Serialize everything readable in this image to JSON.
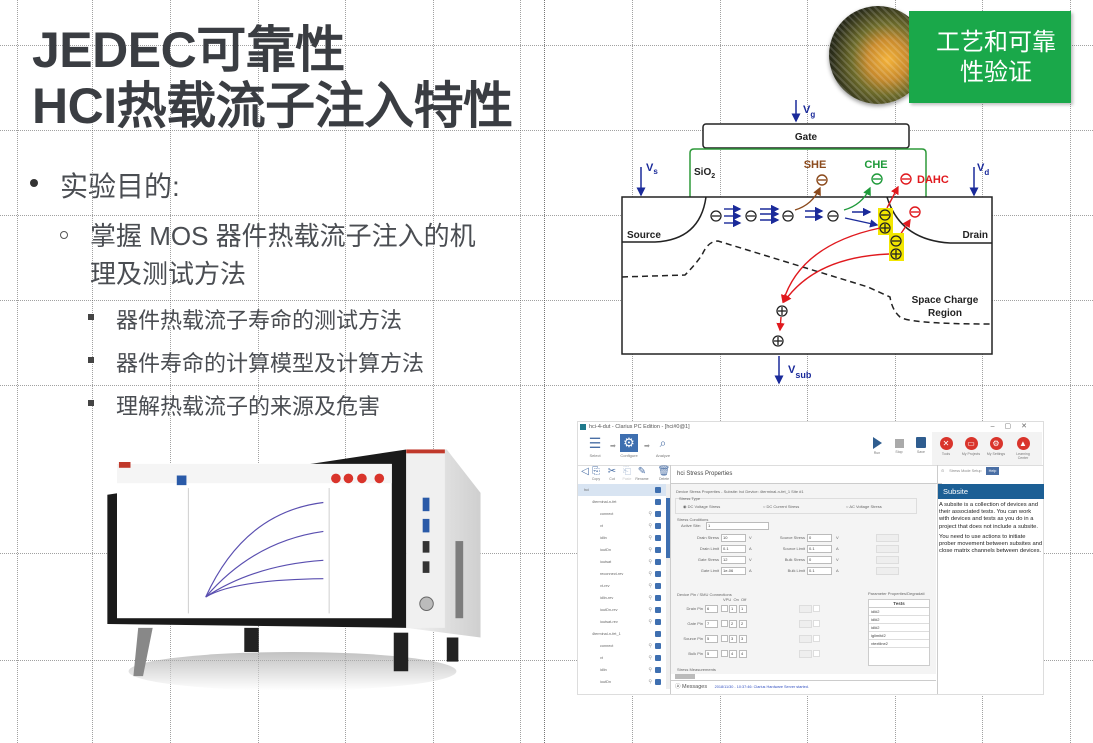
{
  "slide": {
    "title_line1": "JEDEC可靠性",
    "title_line2": "HCI热载流子注入特性",
    "badge_text_line1": "工艺和可靠",
    "badge_text_line2": "性验证",
    "badge_color": "#1aa84a",
    "title_color": "#3a3d42"
  },
  "bullets": {
    "level1": "实验目的:",
    "level2": "掌握 MOS 器件热载流子注入的机理及测试方法",
    "level3": [
      "器件热载流子寿命的测试方法",
      "器件寿命的计算模型及计算方法",
      "理解热载流子的来源及危害"
    ]
  },
  "diagram": {
    "labels": {
      "vg": "V",
      "vg_sub": "g",
      "vs": "V",
      "vs_sub": "s",
      "vd": "V",
      "vd_sub": "d",
      "vsub": "V",
      "vsub_sub": "sub",
      "gate": "Gate",
      "sio2": "SiO",
      "sio2_sub": "2",
      "source": "Source",
      "drain": "Drain",
      "she": "SHE",
      "che": "CHE",
      "dahc": "DAHC",
      "scr_line1": "Space Charge",
      "scr_line2": "Region"
    },
    "colors": {
      "she": "#8b4a1c",
      "che": "#1f9a3a",
      "dahc": "#e0191e",
      "arrows": "#1a2a9a",
      "oxide": "#2e9a3a",
      "highlight": "#f2e600"
    }
  },
  "app": {
    "window_title": "hci-4-dut - Clarius PC Edition - [hci#0@1]",
    "workflow": [
      "Select",
      "Configure",
      "Analyze"
    ],
    "toolbar": [
      "Run",
      "Stop",
      "Save"
    ],
    "toolbar_red": [
      "Tools",
      "My Projects",
      "My Settings",
      "Learning Center"
    ],
    "left_tools": [
      "Copy",
      "Cut",
      "Paste",
      "Rename",
      "Delete"
    ],
    "tree": [
      {
        "label": "hci",
        "level": 0,
        "selected": true
      },
      {
        "label": "4terminal-n-fet",
        "level": 1
      },
      {
        "label": "connect",
        "level": 2
      },
      {
        "label": "vt",
        "level": 2
      },
      {
        "label": "idlin",
        "level": 2
      },
      {
        "label": "ioutDn",
        "level": 2
      },
      {
        "label": "ioutsat",
        "level": 2
      },
      {
        "label": "reconnect-rev",
        "level": 2
      },
      {
        "label": "vt-rev",
        "level": 2
      },
      {
        "label": "idlin-rev",
        "level": 2
      },
      {
        "label": "ioutDn-rev",
        "level": 2
      },
      {
        "label": "ioutsat-rev",
        "level": 2
      },
      {
        "label": "4terminal-n-fet_1",
        "level": 1
      },
      {
        "label": "connect",
        "level": 2
      },
      {
        "label": "vt",
        "level": 2
      },
      {
        "label": "idlin",
        "level": 2
      },
      {
        "label": "ioutDn",
        "level": 2
      }
    ],
    "center_header": "hci Stress Properties",
    "device_props": "Device Stress Properties -  Subsite: hci  Device: 4terminal-n-fet_1  Site #1",
    "stress_type_label": "Stress Type",
    "stress_types": [
      "DC Voltage Stress",
      "DC Current Stress",
      "AC Voltage Stress"
    ],
    "stress_conditions_label": "Stress Conditions",
    "active_site_label": "Active Site:",
    "active_site_value": "1",
    "fields_left": [
      {
        "label": "Drain Stress",
        "value": "10",
        "unit": "V"
      },
      {
        "label": "Drain Limit",
        "value": "0.1",
        "unit": "A"
      },
      {
        "label": "Gate Stress",
        "value": "12",
        "unit": "V"
      },
      {
        "label": "Gate Limit",
        "value": "1e-06",
        "unit": "A"
      }
    ],
    "fields_right": [
      {
        "label": "Source Stress",
        "value": "0",
        "unit": "V"
      },
      {
        "label": "Source Limit",
        "value": "0.1",
        "unit": "A"
      },
      {
        "label": "Bulk Stress",
        "value": "0",
        "unit": "V"
      },
      {
        "label": "Bulk Limit",
        "value": "0.1",
        "unit": "A"
      }
    ],
    "pins_label": "Device Pin / SMU Connections",
    "pins_header": [
      "VPU",
      "On",
      "Off"
    ],
    "pins": [
      {
        "label": "Drain Pin",
        "value": "6",
        "on": "1",
        "off": "1"
      },
      {
        "label": "Gate Pin",
        "value": "7",
        "on": "2",
        "off": "2"
      },
      {
        "label": "Source Pin",
        "value": "5",
        "on": "3",
        "off": "3"
      },
      {
        "label": "Bulk Pin",
        "value": "5",
        "on": "4",
        "off": "4"
      }
    ],
    "param_label": "Parameter Properties/Degradati",
    "tests_header": "Tests",
    "tests": [
      "idl#2",
      "idl#2",
      "idl#2",
      "iglimit#2",
      "vtextline2"
    ],
    "stress_measurements_label": "Stress Measurements",
    "messages_label": "Messages",
    "message_text": "2018/11/30 - 10:37:46: Clarius Hardware Server started.",
    "right_tabs": [
      "Stress Mode Setup",
      "Help"
    ],
    "help_title": "Subsite",
    "help_p1": "A subsite is a collection of devices and their associated tests. You can work with devices and tests as you do in a project that does not include a subsite.",
    "help_p2": "You need to use actions to initiate prober movement between subsites and close matrix channels between devices."
  }
}
